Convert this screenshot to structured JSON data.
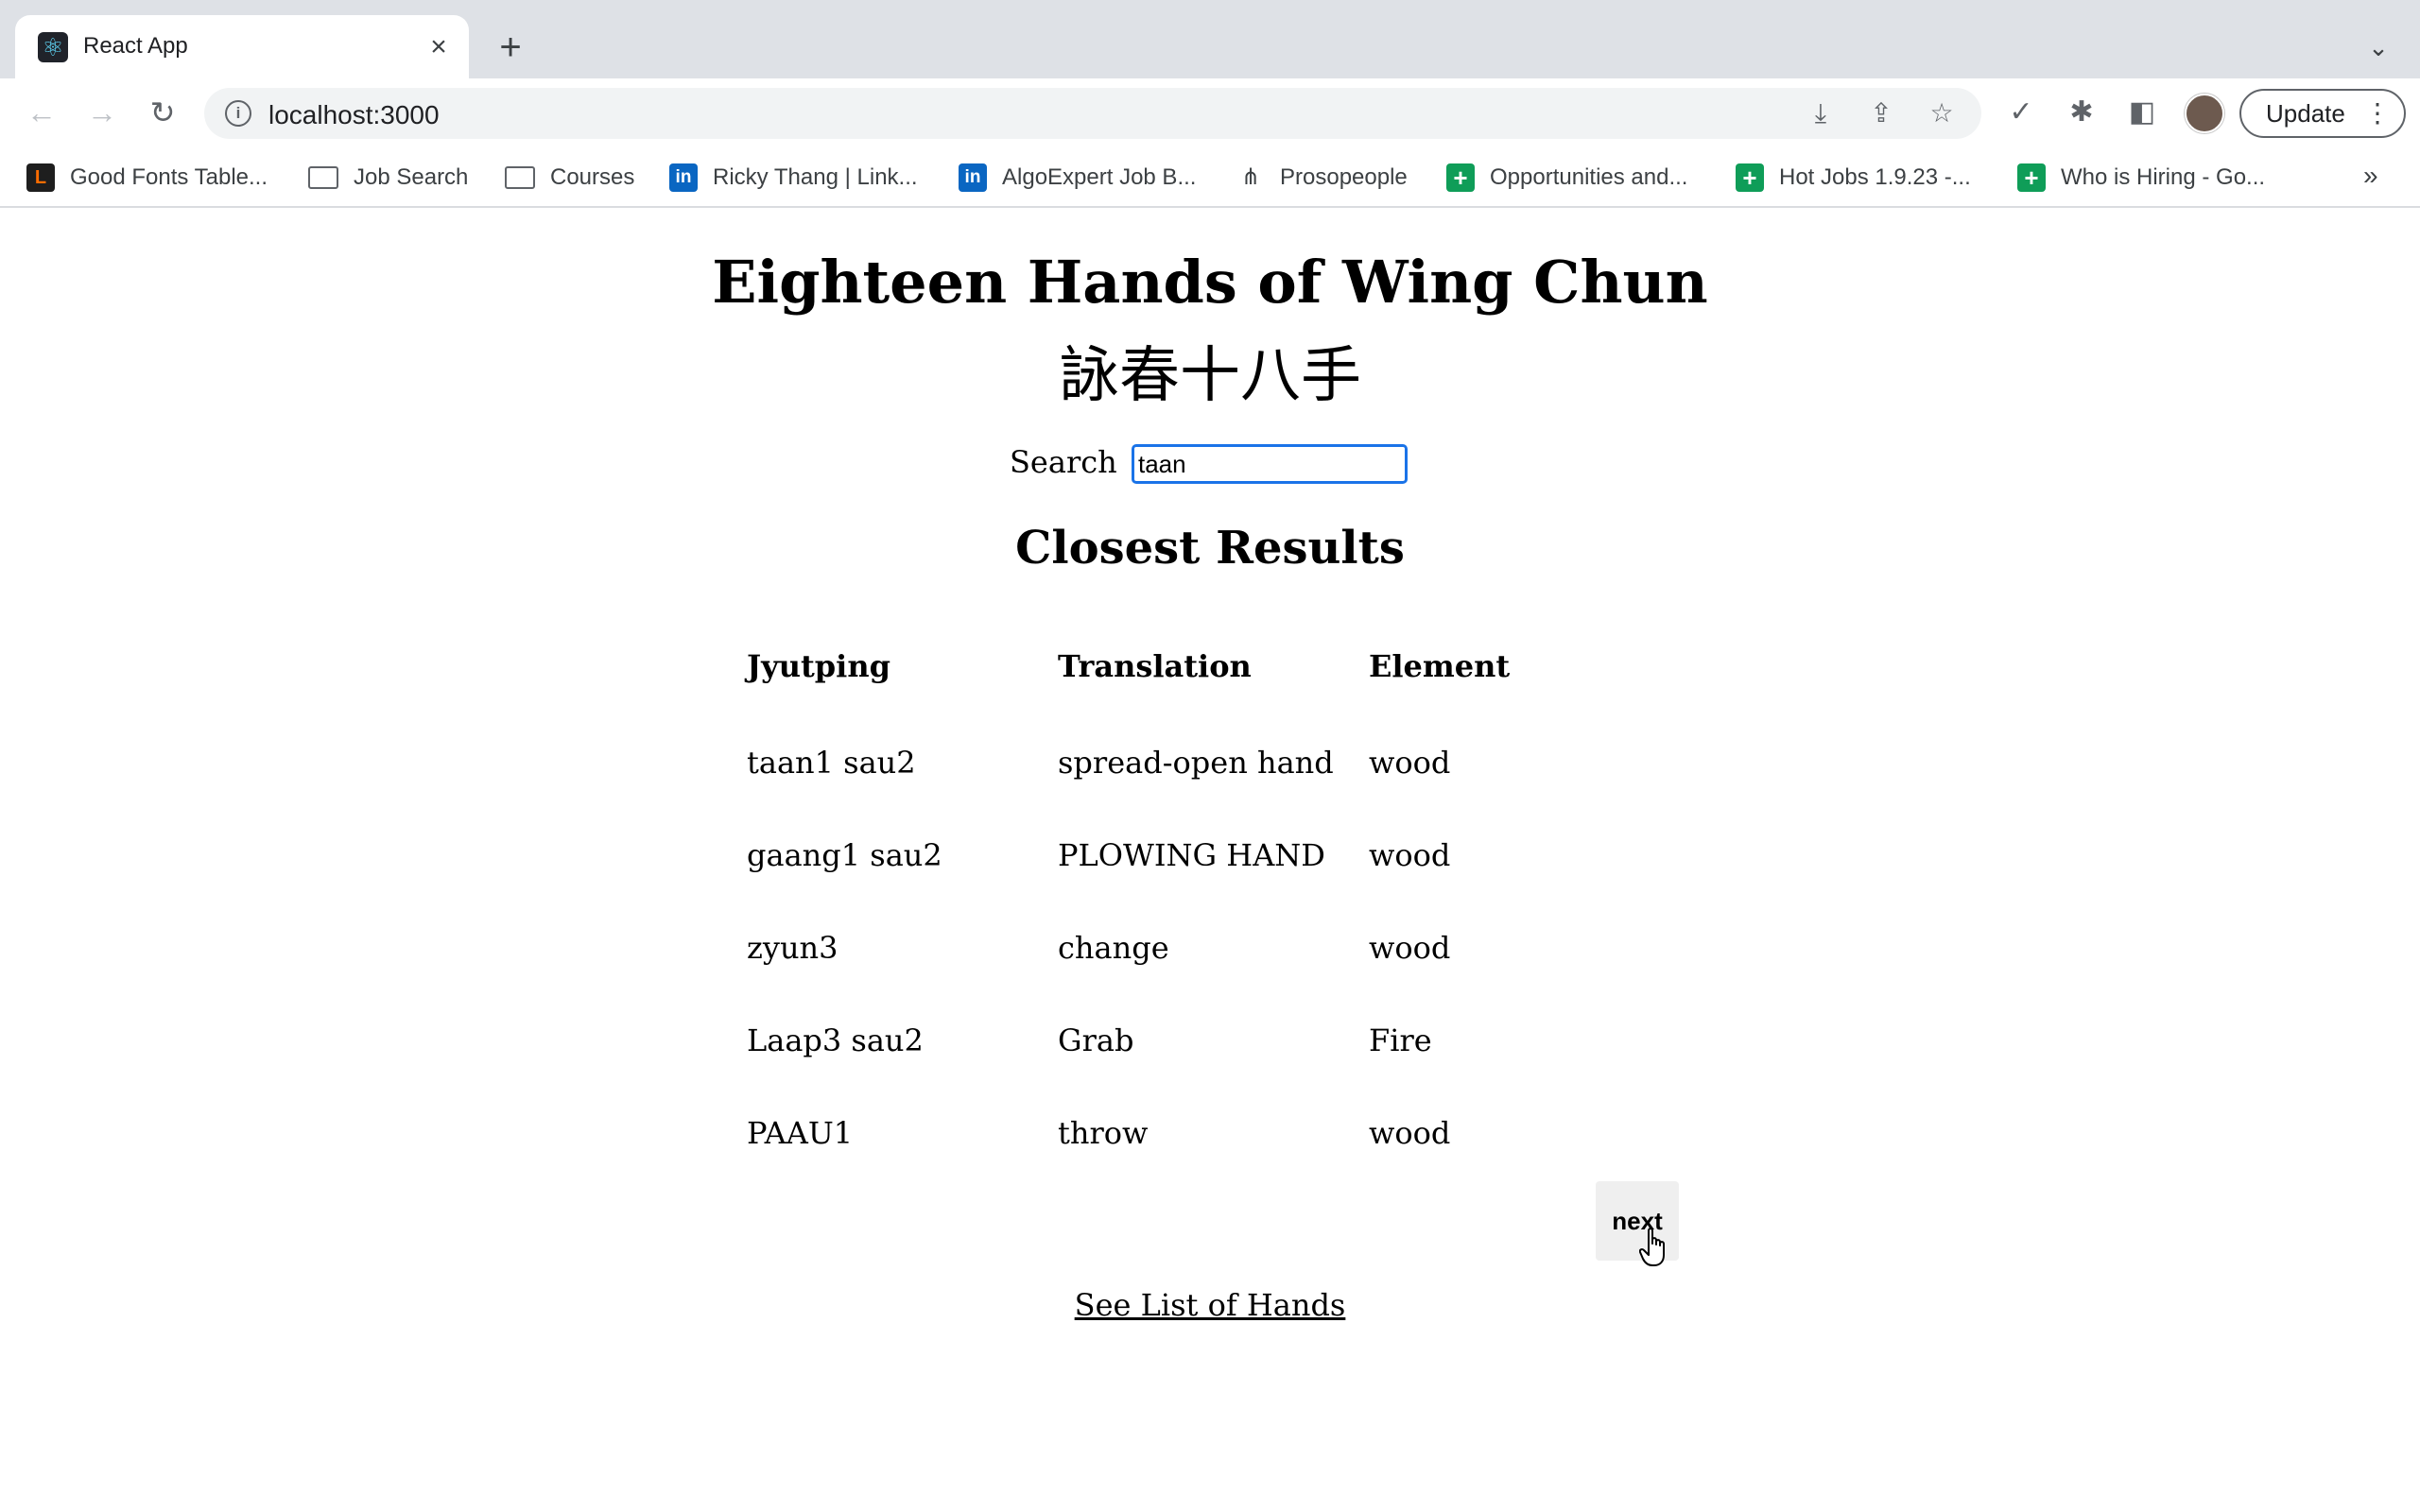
{
  "browser": {
    "tab": {
      "title": "React App",
      "favicon": "react-icon"
    },
    "url": "localhost:3000",
    "update_label": "Update",
    "bookmarks": [
      {
        "label": "Good Fonts Table...",
        "icon": "L"
      },
      {
        "label": "Job Search",
        "icon": "folder-icon"
      },
      {
        "label": "Courses",
        "icon": "folder-icon"
      },
      {
        "label": "Ricky Thang | Link...",
        "icon": "in"
      },
      {
        "label": "AlgoExpert Job B...",
        "icon": "in"
      },
      {
        "label": "Prosopeople",
        "icon": "prosopeople-icon"
      },
      {
        "label": "Opportunities and...",
        "icon": "sheets-icon"
      },
      {
        "label": "Hot Jobs 1.9.23 -...",
        "icon": "sheets-icon"
      },
      {
        "label": "Who is Hiring - Go...",
        "icon": "sheets-icon"
      }
    ],
    "more_bookmarks": "»"
  },
  "page": {
    "title": "Eighteen Hands of Wing Chun",
    "subtitle": "詠春十八手",
    "search_label": "Search",
    "search_value": "taan",
    "results_heading": "Closest Results",
    "columns": [
      "Jyutping",
      "Translation",
      "Element"
    ],
    "rows": [
      [
        "taan1 sau2",
        "spread-open hand",
        "wood"
      ],
      [
        "gaang1 sau2",
        "PLOWING HAND",
        "wood"
      ],
      [
        "zyun3",
        "change",
        "wood"
      ],
      [
        "Laap3 sau2",
        "Grab",
        "Fire"
      ],
      [
        "PAAU1",
        "throw",
        "wood"
      ]
    ],
    "next_label": "next",
    "list_link": "See List of Hands"
  }
}
